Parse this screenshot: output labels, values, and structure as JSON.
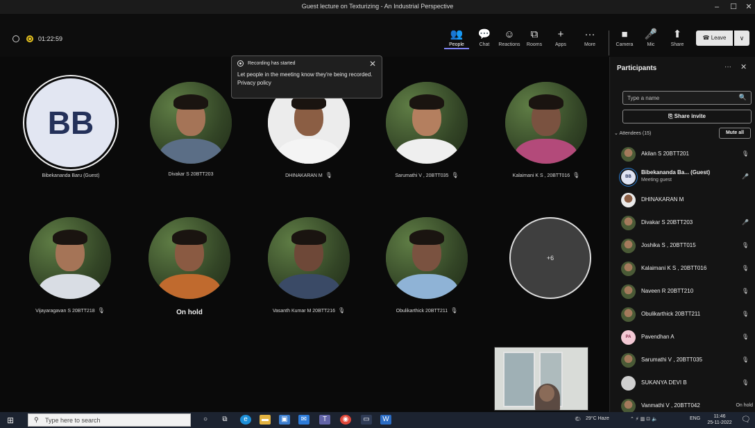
{
  "window": {
    "title": "Guest lecture on Texturizing - An Industrial Perspective",
    "minimize": "–",
    "maximize": "☐",
    "close": "✕"
  },
  "meeting": {
    "timer": "01:22:59"
  },
  "toolbar": [
    {
      "id": "people",
      "label": "People",
      "icon": "people-icon",
      "glyph": "👥",
      "active": true
    },
    {
      "id": "chat",
      "label": "Chat",
      "icon": "chat-icon",
      "glyph": "💬",
      "active": false
    },
    {
      "id": "reactions",
      "label": "Reactions",
      "icon": "reactions-icon",
      "glyph": "☺",
      "active": false
    },
    {
      "id": "rooms",
      "label": "Rooms",
      "icon": "rooms-icon",
      "glyph": "⧉",
      "active": false
    },
    {
      "id": "apps",
      "label": "Apps",
      "icon": "apps-icon",
      "glyph": "+",
      "active": false
    },
    {
      "id": "more",
      "label": "More",
      "icon": "more-icon",
      "glyph": "···",
      "active": false
    },
    {
      "id": "camera",
      "label": "Camera",
      "icon": "camera-icon",
      "glyph": "■",
      "active": false
    },
    {
      "id": "mic",
      "label": "Mic",
      "icon": "mic-icon",
      "glyph": "🎤",
      "active": false
    },
    {
      "id": "share",
      "label": "Share",
      "icon": "share-screen-icon",
      "glyph": "⬆",
      "active": false
    }
  ],
  "leave": {
    "label": "Leave",
    "caret": "∨",
    "icon": "phone-icon"
  },
  "notification": {
    "title": "Recording has started",
    "body": "Let people in the meeting know they're being recorded. Privacy policy",
    "close": "✕"
  },
  "grid": {
    "row1": [
      {
        "name": "Bibekananda Baru (Guest)",
        "initials": "BB",
        "mic": false
      },
      {
        "name": "Divakar S 20BTT203",
        "mic": false
      },
      {
        "name": "DHINAKARAN M",
        "mic": true
      },
      {
        "name": "Sarumathi V , 20BTT035",
        "mic": true
      },
      {
        "name": "Kalaimani K S , 20BTT016",
        "mic": true
      }
    ],
    "row2": [
      {
        "name": "Vijayaragavan S 20BTT218",
        "mic": true
      },
      {
        "hold": "On hold"
      },
      {
        "name": "Vasanth Kumar M 20BTT216",
        "mic": true
      },
      {
        "name": "Obulikarthick 20BTT211",
        "mic": true
      },
      {
        "more": "+6"
      }
    ],
    "mic_glyph": "🎙"
  },
  "panel": {
    "title": "Participants",
    "more": "···",
    "close": "✕",
    "search_placeholder": "Type a name",
    "share_invite": "Share invite",
    "attendees_label": "Attendees (15)",
    "mute_all": "Mute all",
    "attendees": [
      {
        "name": "Akilan S 20BTT201",
        "status": "🎙"
      },
      {
        "name": "Bibekananda Ba... (Guest)",
        "sub": "Meeting guest",
        "initials": "BB",
        "status": "🎤"
      },
      {
        "name": "DHINAKARAN M",
        "status": ""
      },
      {
        "name": "Divakar S 20BTT203",
        "status": "🎤"
      },
      {
        "name": "Joshika S , 20BTT015",
        "status": "🎙"
      },
      {
        "name": "Kalaimani K S , 20BTT016",
        "status": "🎙"
      },
      {
        "name": "Naveen R 20BTT210",
        "status": "🎙"
      },
      {
        "name": "Obulikarthick 20BTT211",
        "status": "🎙"
      },
      {
        "name": "Pavendhan A",
        "initials": "PA",
        "status": "🎙"
      },
      {
        "name": "Sarumathi V , 20BTT035",
        "status": "🎙"
      },
      {
        "name": "SUKANYA DEVI B",
        "status": "🎙"
      },
      {
        "name": "Vanmathi V , 20BTT042",
        "status": "On hold"
      }
    ]
  },
  "taskbar": {
    "search_placeholder": "Type here to search",
    "weather": "29°C Haze",
    "lang": "ENG",
    "time": "11:46",
    "date": "25-11-2022"
  }
}
